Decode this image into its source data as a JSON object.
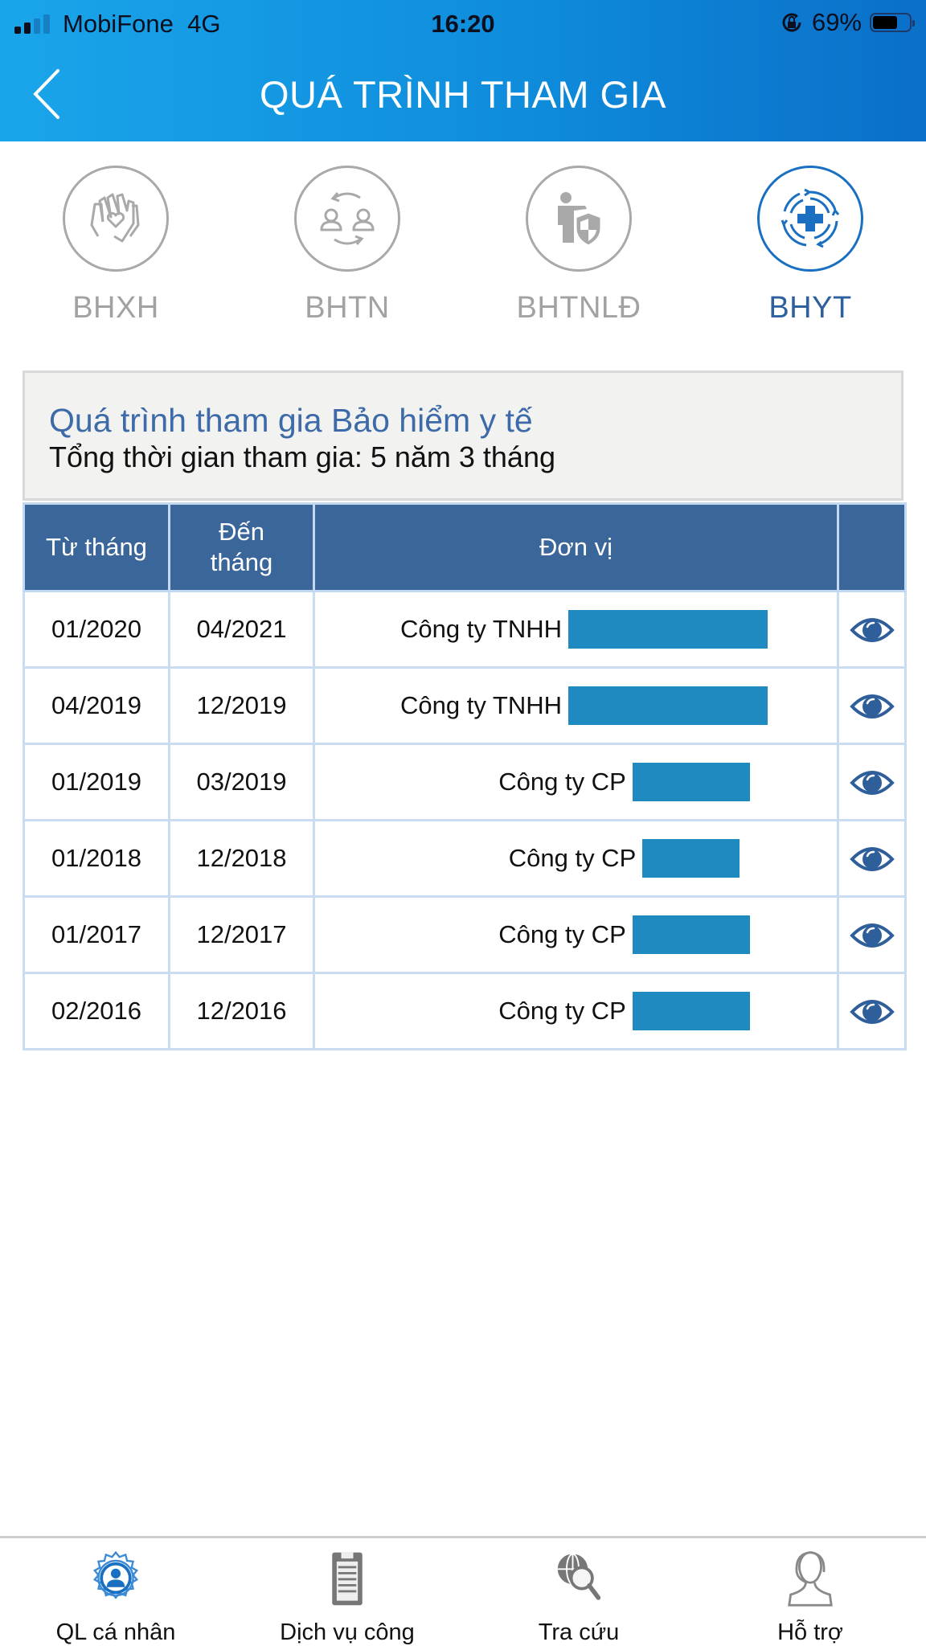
{
  "status_bar": {
    "carrier": "MobiFone",
    "network": "4G",
    "time": "16:20",
    "battery_percent": "69%",
    "signal_bars_filled": 2,
    "signal_bars_total": 4,
    "battery_level": 0.69,
    "icons": [
      "signal-icon",
      "orientation-lock-icon",
      "battery-icon"
    ]
  },
  "header": {
    "title": "QUÁ TRÌNH THAM GIA",
    "back_icon": "chevron-left-icon",
    "gradient_colors": [
      "#1aa5ea",
      "#0a6fc8"
    ]
  },
  "tabs": [
    {
      "label": "BHXH",
      "icon": "hands-heart-icon",
      "active": false
    },
    {
      "label": "BHTN",
      "icon": "people-exchange-icon",
      "active": false
    },
    {
      "label": "BHTNLĐ",
      "icon": "worker-shield-icon",
      "active": false
    },
    {
      "label": "BHYT",
      "icon": "medical-cross-icon",
      "active": true
    }
  ],
  "summary": {
    "title": "Quá trình tham gia Bảo hiểm y tế",
    "total": "Tổng thời gian tham gia: 5 năm 3 tháng"
  },
  "table": {
    "columns": [
      "Từ tháng",
      "Đến\ntháng",
      "Đơn vị",
      ""
    ],
    "columns_display": {
      "from": "Từ tháng",
      "to_line1": "Đến",
      "to_line2": "tháng",
      "unit": "Đơn vị"
    },
    "rows": [
      {
        "from": "01/2020",
        "to": "04/2021",
        "unit": "Công ty TNHH",
        "redacted": true,
        "action_icon": "eye-icon"
      },
      {
        "from": "04/2019",
        "to": "12/2019",
        "unit": "Công ty TNHH",
        "redacted": true,
        "action_icon": "eye-icon"
      },
      {
        "from": "01/2019",
        "to": "03/2019",
        "unit": "Công ty CP",
        "redacted": true,
        "action_icon": "eye-icon"
      },
      {
        "from": "01/2018",
        "to": "12/2018",
        "unit": "Công ty CP",
        "redacted": true,
        "action_icon": "eye-icon"
      },
      {
        "from": "01/2017",
        "to": "12/2017",
        "unit": "Công ty CP",
        "redacted": true,
        "action_icon": "eye-icon"
      },
      {
        "from": "02/2016",
        "to": "12/2016",
        "unit": "Công ty CP",
        "redacted": true,
        "action_icon": "eye-icon"
      }
    ]
  },
  "bottom_nav": [
    {
      "label": "QL cá nhân",
      "icon": "user-gear-icon",
      "active": true
    },
    {
      "label": "Dịch vụ công",
      "icon": "clipboard-icon",
      "active": false
    },
    {
      "label": "Tra cứu",
      "icon": "globe-search-icon",
      "active": false
    },
    {
      "label": "Hỗ trợ",
      "icon": "support-headset-icon",
      "active": false
    }
  ],
  "colors": {
    "accent": "#1a6fc1",
    "table_header": "#3b6699",
    "summary_title": "#3d6aa8",
    "redaction": "#1f8abf",
    "inactive_icon": "#a9a9a9"
  }
}
